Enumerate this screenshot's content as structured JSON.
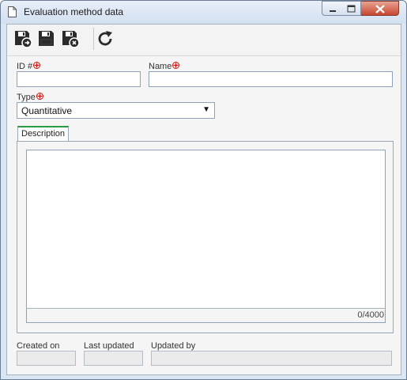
{
  "window": {
    "title": "Evaluation method data",
    "icon": "document-icon",
    "controls": [
      "minimize-icon",
      "maximize-icon",
      "close-icon"
    ]
  },
  "toolbar": {
    "buttons": [
      {
        "name": "save-and-new-button",
        "icon": "floppy-plus-icon"
      },
      {
        "name": "save-button",
        "icon": "floppy-icon"
      },
      {
        "name": "save-and-exit-button",
        "icon": "floppy-close-icon"
      },
      {
        "name": "refresh-button",
        "icon": "refresh-icon"
      }
    ]
  },
  "form": {
    "id_label": "ID #",
    "id_value": "",
    "name_label": "Name",
    "name_value": "",
    "type_label": "Type",
    "type_value": "Quantitative",
    "required_icon": "required-icon",
    "required_color": "#cc1111"
  },
  "tabs": [
    {
      "label": "Description",
      "active": true
    }
  ],
  "description": {
    "value": "",
    "counter": "0/4000"
  },
  "footer": {
    "created_on_label": "Created on",
    "last_updated_label": "Last updated",
    "updated_by_label": "Updated by",
    "created_on_value": "",
    "last_updated_value": "",
    "updated_by_value": ""
  },
  "colors": {
    "tab_accent": "#2c9a3f",
    "close_button": "#c7462f",
    "frame": "#dbe6f3"
  }
}
